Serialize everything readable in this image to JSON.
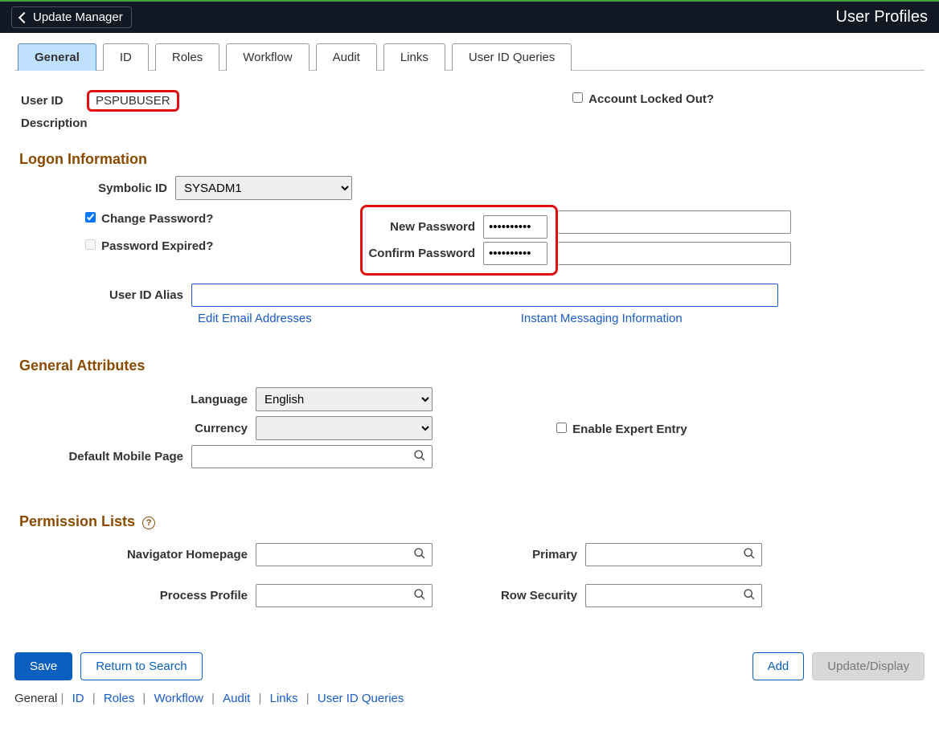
{
  "header": {
    "back_label": "Update Manager",
    "title": "User Profiles"
  },
  "tabs": [
    "General",
    "ID",
    "Roles",
    "Workflow",
    "Audit",
    "Links",
    "User ID Queries"
  ],
  "active_tab": "General",
  "identity": {
    "user_id_label": "User ID",
    "user_id_value": "PSPUBUSER",
    "description_label": "Description",
    "account_locked_label": "Account Locked Out?",
    "account_locked_checked": false
  },
  "logon": {
    "section_title": "Logon Information",
    "symbolic_id_label": "Symbolic ID",
    "symbolic_id_value": "SYSADM1",
    "symbolic_id_options": [
      "SYSADM1"
    ],
    "change_password_label": "Change Password?",
    "change_password_checked": true,
    "password_expired_label": "Password Expired?",
    "password_expired_checked": false,
    "new_password_label": "New Password",
    "new_password_value": "••••••••••",
    "confirm_password_label": "Confirm Password",
    "confirm_password_value": "••••••••••",
    "user_id_alias_label": "User ID Alias",
    "user_id_alias_value": "",
    "edit_email_link": "Edit Email Addresses",
    "im_link": "Instant Messaging Information"
  },
  "general_attributes": {
    "section_title": "General Attributes",
    "language_label": "Language",
    "language_value": "English",
    "language_options": [
      "English"
    ],
    "currency_label": "Currency",
    "currency_value": "",
    "currency_options": [
      ""
    ],
    "default_mobile_label": "Default Mobile Page",
    "default_mobile_value": "",
    "enable_expert_label": "Enable Expert Entry",
    "enable_expert_checked": false
  },
  "permission_lists": {
    "section_title": "Permission Lists",
    "navigator_homepage_label": "Navigator Homepage",
    "navigator_homepage_value": "",
    "process_profile_label": "Process Profile",
    "process_profile_value": "",
    "primary_label": "Primary",
    "primary_value": "",
    "row_security_label": "Row Security",
    "row_security_value": ""
  },
  "actions": {
    "save": "Save",
    "return_to_search": "Return to Search",
    "add": "Add",
    "update_display": "Update/Display"
  },
  "footer_links": [
    "General",
    "ID",
    "Roles",
    "Workflow",
    "Audit",
    "Links",
    "User ID Queries"
  ]
}
